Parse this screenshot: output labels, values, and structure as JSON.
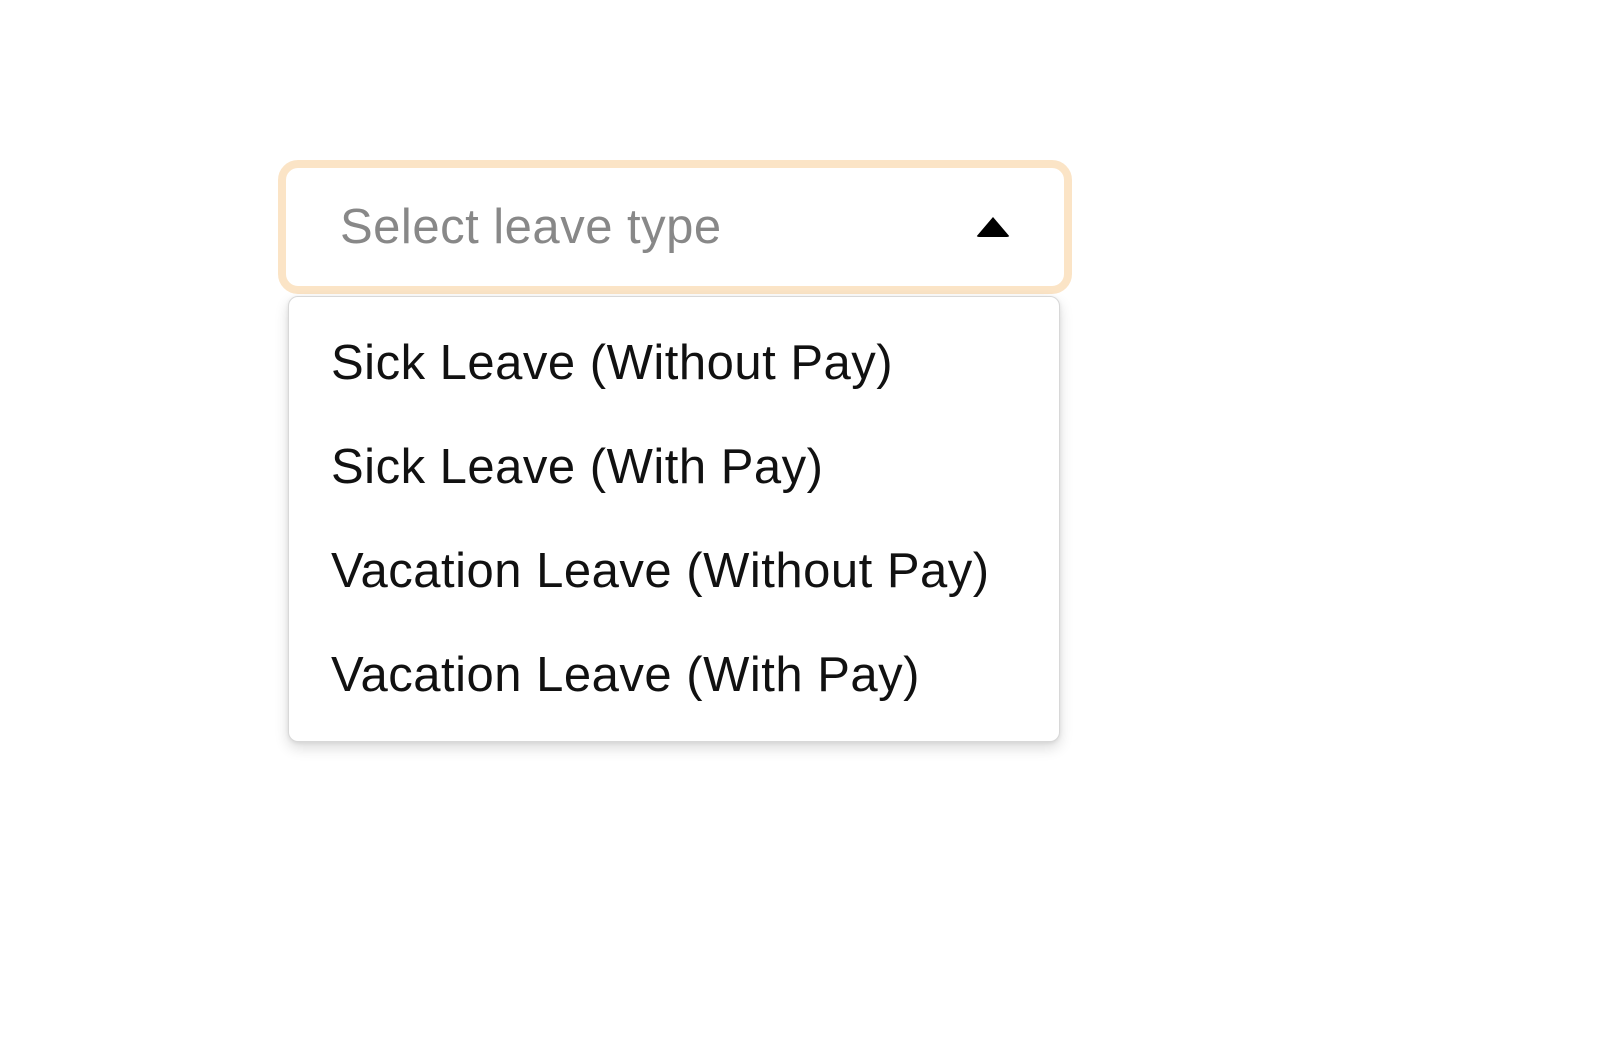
{
  "dropdown": {
    "placeholder": "Select leave type",
    "options": [
      "Sick Leave (Without Pay)",
      "Sick Leave (With Pay)",
      "Vacation Leave (Without Pay)",
      "Vacation Leave (With Pay)"
    ]
  }
}
